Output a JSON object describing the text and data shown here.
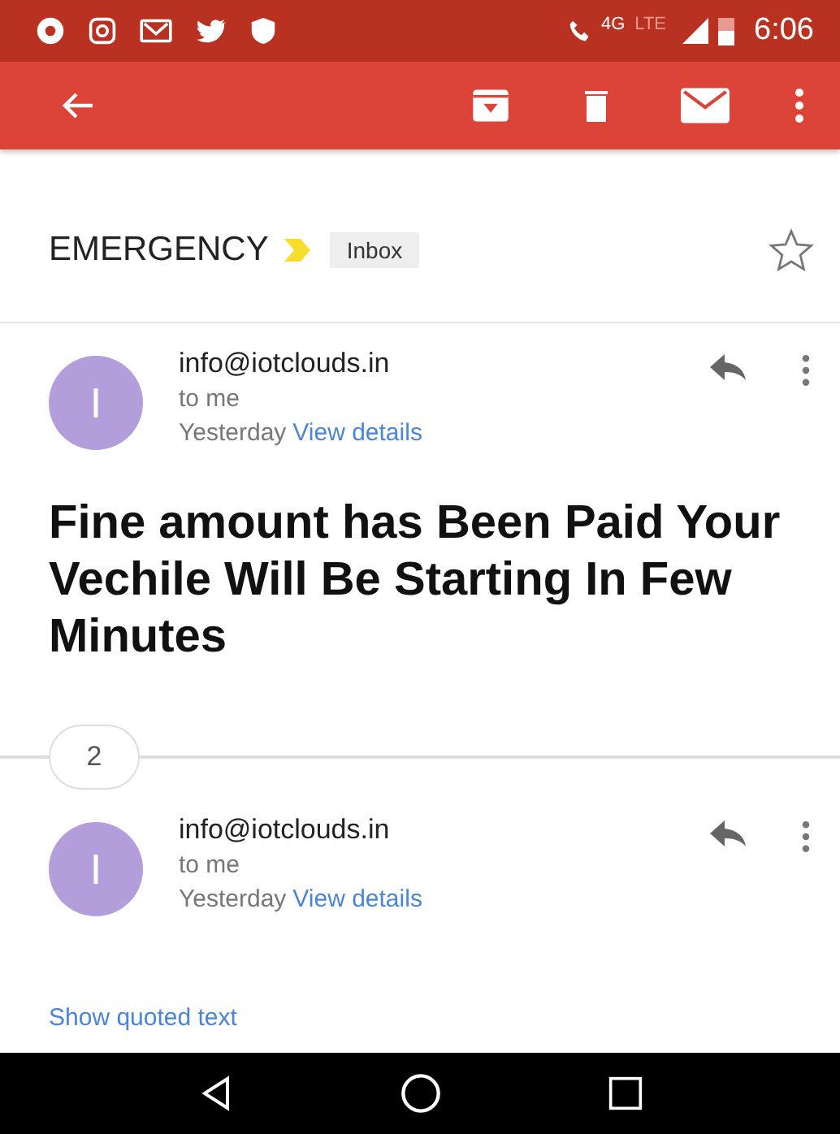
{
  "status_bar": {
    "network": "4G",
    "network_2": "LTE",
    "time": "6:06"
  },
  "subject": {
    "title": "EMERGENCY",
    "important": true,
    "label": "Inbox",
    "starred": false
  },
  "messages": [
    {
      "avatar_letter": "I",
      "sender": "info@iotclouds.in",
      "recipient": "to me",
      "date": "Yesterday",
      "details_link": "View details",
      "body": "Fine amount has Been Paid Your Vechile Will Be Starting In Few Minutes"
    },
    {
      "avatar_letter": "I",
      "sender": "info@iotclouds.in",
      "recipient": "to me",
      "date": "Yesterday",
      "details_link": "View details",
      "quoted_link": "Show quoted text"
    }
  ],
  "collapsed_count": "2"
}
